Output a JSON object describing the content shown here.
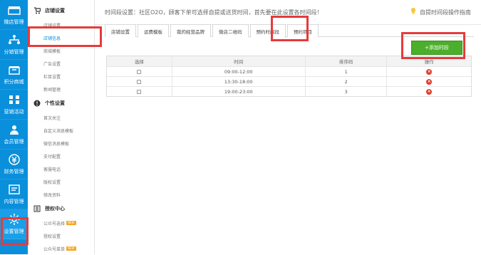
{
  "sidebar": {
    "items": [
      {
        "label": "微店管理",
        "icon": "shop-icon"
      },
      {
        "label": "分销管理",
        "icon": "distribution-icon"
      },
      {
        "label": "积分商城",
        "icon": "points-shop-icon"
      },
      {
        "label": "营销活动",
        "icon": "marketing-icon"
      },
      {
        "label": "会员管理",
        "icon": "member-icon"
      },
      {
        "label": "财务管理",
        "icon": "finance-icon"
      },
      {
        "label": "内容管理",
        "icon": "content-icon"
      },
      {
        "label": "设置管理",
        "icon": "settings-icon"
      }
    ]
  },
  "submenu": {
    "groups": [
      {
        "title": "店铺设置",
        "icon": "cart-icon",
        "items": [
          "店铺设置",
          "店铺信息",
          "商城模板",
          "广告设置",
          "栏目设置",
          "新闻管理"
        ]
      },
      {
        "title": "个性设置",
        "icon": "alert-icon",
        "items": [
          "首次关注",
          "自定义消息模板",
          "微信消息模板",
          "支付配置",
          "客服电话",
          "版权设置",
          "修改资料"
        ]
      },
      {
        "title": "授权中心",
        "icon": "auth-icon",
        "items": [
          {
            "label": "公众号选择",
            "badge": "NEW"
          },
          {
            "label": "授权设置"
          },
          {
            "label": "公众号菜单",
            "badge": "NEW"
          }
        ]
      }
    ]
  },
  "header": {
    "notice": "时间段设置：社区O2O，顾客下单可选择自提或送货时间，首先要在此设置各时间段！",
    "guide": "自提时间段操作指南"
  },
  "tabs": [
    "店铺设置",
    "运费模板",
    "我的经营品牌",
    "微店二维码",
    "预约时间段",
    "预约项目"
  ],
  "actions": {
    "add": "+添加时段"
  },
  "table": {
    "headers": [
      "选择",
      "时间",
      "排序码",
      "操作"
    ],
    "rows": [
      {
        "time": "09:00-12:00",
        "sort": "1"
      },
      {
        "time": "13:30-18:00",
        "sort": "2"
      },
      {
        "time": "19:00-23:00",
        "sort": "3"
      }
    ]
  },
  "colors": {
    "sidebar": "#0A8FDB",
    "primary": "#4CAF2B",
    "highlight": "#E53B3B",
    "delete": "#E23B2B"
  }
}
